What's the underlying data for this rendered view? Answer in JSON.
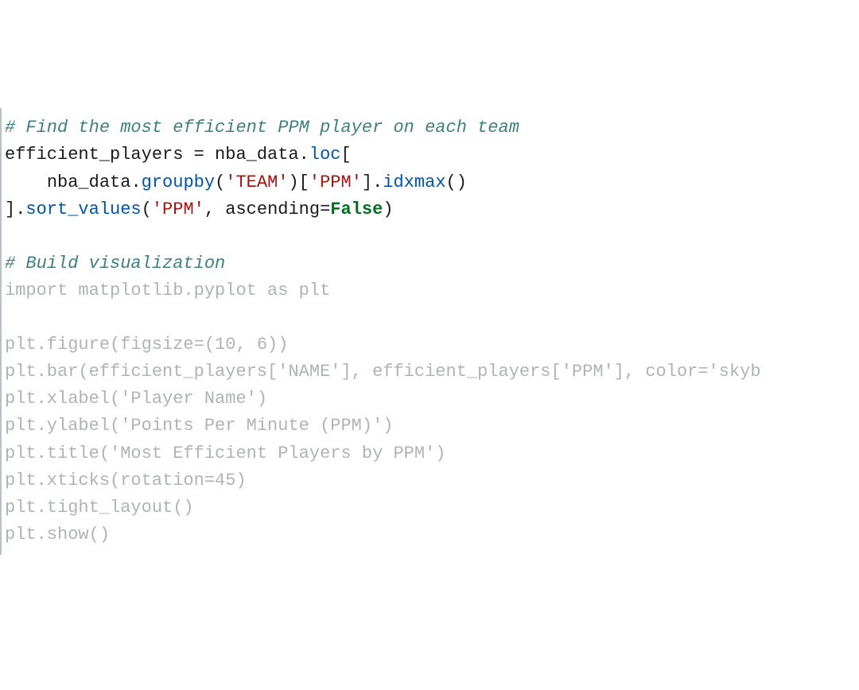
{
  "code": {
    "l1_comment": "# Find the most efficient PPM player on each team",
    "l2_ident": "efficient_players ",
    "l2_punct1": "= ",
    "l2_ident2": "nba_data",
    "l2_punct2": ".",
    "l2_member": "loc",
    "l2_punct3": "[",
    "l3_indent": "    ",
    "l3_ident": "nba_data",
    "l3_punct1": ".",
    "l3_member1": "groupby",
    "l3_punct2": "(",
    "l3_str1": "'TEAM'",
    "l3_punct3": ")[",
    "l3_str2": "'PPM'",
    "l3_punct4": "]",
    "l3_punct5": ".",
    "l3_member2": "idxmax",
    "l3_punct6": "()",
    "l4_punct1": "]",
    "l4_punct2": ".",
    "l4_member": "sort_values",
    "l4_punct3": "(",
    "l4_str": "'PPM'",
    "l4_punct4": ", ",
    "l4_ident": "ascending",
    "l4_punct5": "=",
    "l4_kw": "False",
    "l4_punct6": ")",
    "l5_blank": " ",
    "l6_comment": "# Build visualization",
    "l7": "import matplotlib.pyplot as plt",
    "l8_blank": " ",
    "l9": "plt.figure(figsize=(10, 6))",
    "l10": "plt.bar(efficient_players['NAME'], efficient_players['PPM'], color='skyb",
    "l11": "plt.xlabel('Player Name')",
    "l12": "plt.ylabel('Points Per Minute (PPM)')",
    "l13": "plt.title('Most Efficient Players by PPM')",
    "l14": "plt.xticks(rotation=45)",
    "l15": "plt.tight_layout()",
    "l16": "plt.show()"
  }
}
